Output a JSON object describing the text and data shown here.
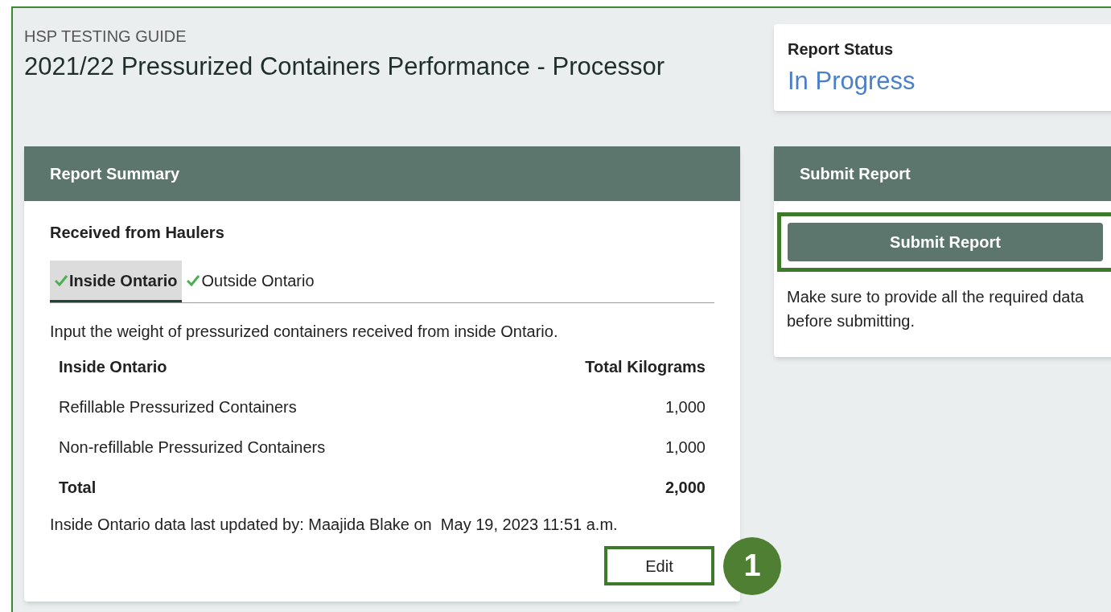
{
  "header": {
    "subtitle": "HSP TESTING GUIDE",
    "title": "2021/22 Pressurized Containers Performance - Processor"
  },
  "status_card": {
    "label": "Report Status",
    "value": "In Progress"
  },
  "summary": {
    "heading": "Report Summary",
    "section_title": "Received from Haulers",
    "tabs": [
      {
        "label": "Inside Ontario",
        "selected": true,
        "complete": true
      },
      {
        "label": "Outside Ontario",
        "selected": false,
        "complete": true
      }
    ],
    "instruction": "Input the weight of pressurized containers received from inside Ontario.",
    "table": {
      "columns": [
        "Inside Ontario",
        "Total Kilograms"
      ],
      "rows": [
        {
          "kind": "item",
          "cells": [
            "Refillable Pressurized Containers",
            "1,000"
          ]
        },
        {
          "kind": "item",
          "cells": [
            "Non-refillable Pressurized Containers",
            "1,000"
          ]
        },
        {
          "kind": "total",
          "cells": [
            "Total",
            "2,000"
          ]
        }
      ]
    },
    "updated_note": "Inside Ontario data last updated by: Maajida Blake on  May 19, 2023 11:51 a.m.",
    "edit_button": {
      "label": "Edit",
      "highlighted": true
    },
    "callout": "1"
  },
  "submit_card": {
    "heading": "Submit Report",
    "button": {
      "label": "Submit Report",
      "highlighted": true
    },
    "note": "Make sure to provide all the required data before submitting."
  }
}
